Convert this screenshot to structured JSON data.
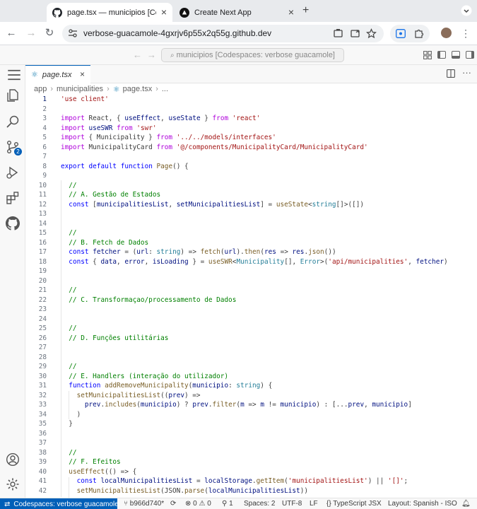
{
  "browser": {
    "tabs": [
      {
        "title": "page.tsx — municipios [Codespaces: verbose guacamole]",
        "icon": "github-icon",
        "active": true
      },
      {
        "title": "Create Next App",
        "icon": "vercel-icon",
        "active": false
      }
    ],
    "url": "verbose-guacamole-4gxrjv6p55x2q55g.github.dev"
  },
  "vscode": {
    "command_center": "municipios [Codespaces: verbose guacamole]",
    "tab": {
      "filename": "page.tsx"
    },
    "breadcrumb": [
      "app",
      "municipalities",
      "page.tsx",
      "..."
    ],
    "scm_badge": "2",
    "current_line": 1
  },
  "code_lines": [
    "'use client'",
    "",
    "import React, { useEffect, useState } from 'react'",
    "import useSWR from 'swr'",
    "import { Municipality } from '../../models/interfaces'",
    "import MunicipalityCard from '@/components/MunicipalityCard/MunicipalityCard'",
    "",
    "export default function Page() {",
    "",
    "  //",
    "  // A. Gestão de Estados",
    "  const [municipalitiesList, setMunicipalitiesList] = useState<string[]>([])",
    "",
    "",
    "  //",
    "  // B. Fetch de Dados",
    "  const fetcher = (url: string) => fetch(url).then(res => res.json())",
    "  const { data, error, isLoading } = useSWR<Municipality[], Error>('api/municipalities', fetcher)",
    "",
    "",
    "  //",
    "  // C. Transformaçao/processamento de Dados",
    "",
    "",
    "  //",
    "  // D. Funções utilitárias",
    "",
    "",
    "  //",
    "  // E. Handlers (interação do utilizador)",
    "  function addRemoveMunicipality(municipio: string) {",
    "    setMunicipalitiesList((prev) =>",
    "      prev.includes(municipio) ? prev.filter(m => m != municipio) : [...prev, municipio]",
    "    )",
    "  }",
    "",
    "",
    "  //",
    "  // F. Efeitos",
    "  useEffect(() => {",
    "    const localMunicipalitiesList = localStorage.getItem('municipalitiesList') || '[]';",
    "    setMunicipalitiesList(JSON.parse(localMunicipalitiesList))"
  ],
  "status_bar": {
    "remote": "Codespaces: verbose guacamole",
    "branch": "b966d740*",
    "errors": "0",
    "warnings": "0",
    "ports": "1",
    "spaces": "Spaces: 2",
    "encoding": "UTF-8",
    "eol": "LF",
    "language": "TypeScript JSX",
    "layout": "Layout: Spanish - ISO"
  }
}
